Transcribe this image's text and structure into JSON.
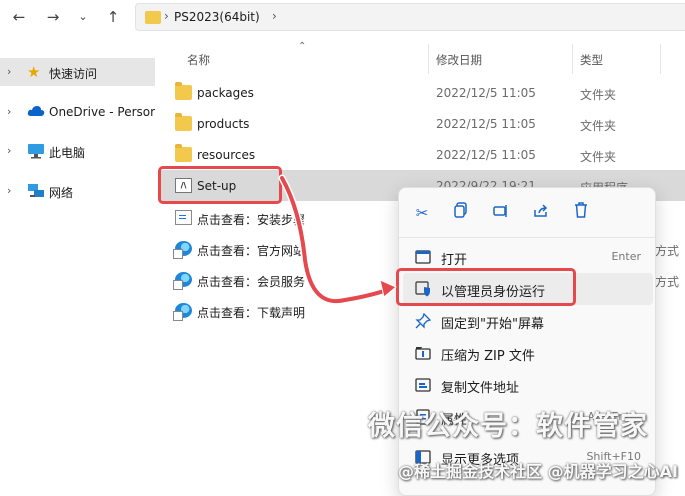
{
  "address": {
    "path": "PS2023(64bit)"
  },
  "sidebar": {
    "items": [
      {
        "label": "快速访问",
        "icon": "star-icon",
        "selected": true
      },
      {
        "label": "OneDrive - Persor",
        "icon": "cloud-icon",
        "selected": false
      },
      {
        "label": "此电脑",
        "icon": "monitor-icon",
        "selected": false
      },
      {
        "label": "网络",
        "icon": "network-icon",
        "selected": false
      }
    ]
  },
  "columns": {
    "name": "名称",
    "date": "修改日期",
    "type": "类型"
  },
  "files": [
    {
      "name": "packages",
      "date": "2022/12/5 11:05",
      "type": "文件夹",
      "icon": "folder-icon"
    },
    {
      "name": "products",
      "date": "2022/12/5 11:05",
      "type": "文件夹",
      "icon": "folder-icon"
    },
    {
      "name": "resources",
      "date": "2022/12/5 11:05",
      "type": "文件夹",
      "icon": "folder-icon"
    },
    {
      "name": "Set-up",
      "date": "2022/9/22 19:21",
      "type": "应用程序",
      "icon": "ps-installer-icon",
      "selected": true
    },
    {
      "name": "点击查看：安装步骤",
      "date": "",
      "type": "",
      "icon": "document-icon"
    },
    {
      "name": "点击查看：官方网站",
      "date": "",
      "type": "方式",
      "icon": "edge-shortcut-icon"
    },
    {
      "name": "点击查看：会员服务",
      "date": "",
      "type": "方式",
      "icon": "edge-shortcut-icon"
    },
    {
      "name": "点击查看：下载声明",
      "date": "",
      "type": "",
      "icon": "edge-shortcut-icon"
    }
  ],
  "context_menu": {
    "quick_actions": [
      "cut-icon",
      "copy-icon",
      "rename-icon",
      "share-icon",
      "delete-icon"
    ],
    "items": [
      {
        "label": "打开",
        "shortcut": "Enter",
        "icon": "open-icon"
      },
      {
        "label": "以管理员身份运行",
        "shortcut": "",
        "icon": "shield-icon",
        "highlighted": true
      },
      {
        "label": "固定到\"开始\"屏幕",
        "shortcut": "",
        "icon": "pin-icon"
      },
      {
        "label": "压缩为 ZIP 文件",
        "shortcut": "",
        "icon": "zip-icon"
      },
      {
        "label": "复制文件地址",
        "shortcut": "",
        "icon": "copy-path-icon"
      },
      {
        "label": "属性",
        "shortcut": "Alt+Enter",
        "icon": "properties-icon"
      },
      {
        "label": "显示更多选项",
        "shortcut": "Shift+F10",
        "icon": "more-options-icon"
      }
    ]
  },
  "watermark": {
    "line1": "微信公众号：软件管家",
    "line2": "@稀土掘金技术社区 @机器学习之心AI"
  },
  "colors": {
    "accent": "#1a66c8",
    "highlight": "#e5484d",
    "folder": "#f2c94c"
  }
}
